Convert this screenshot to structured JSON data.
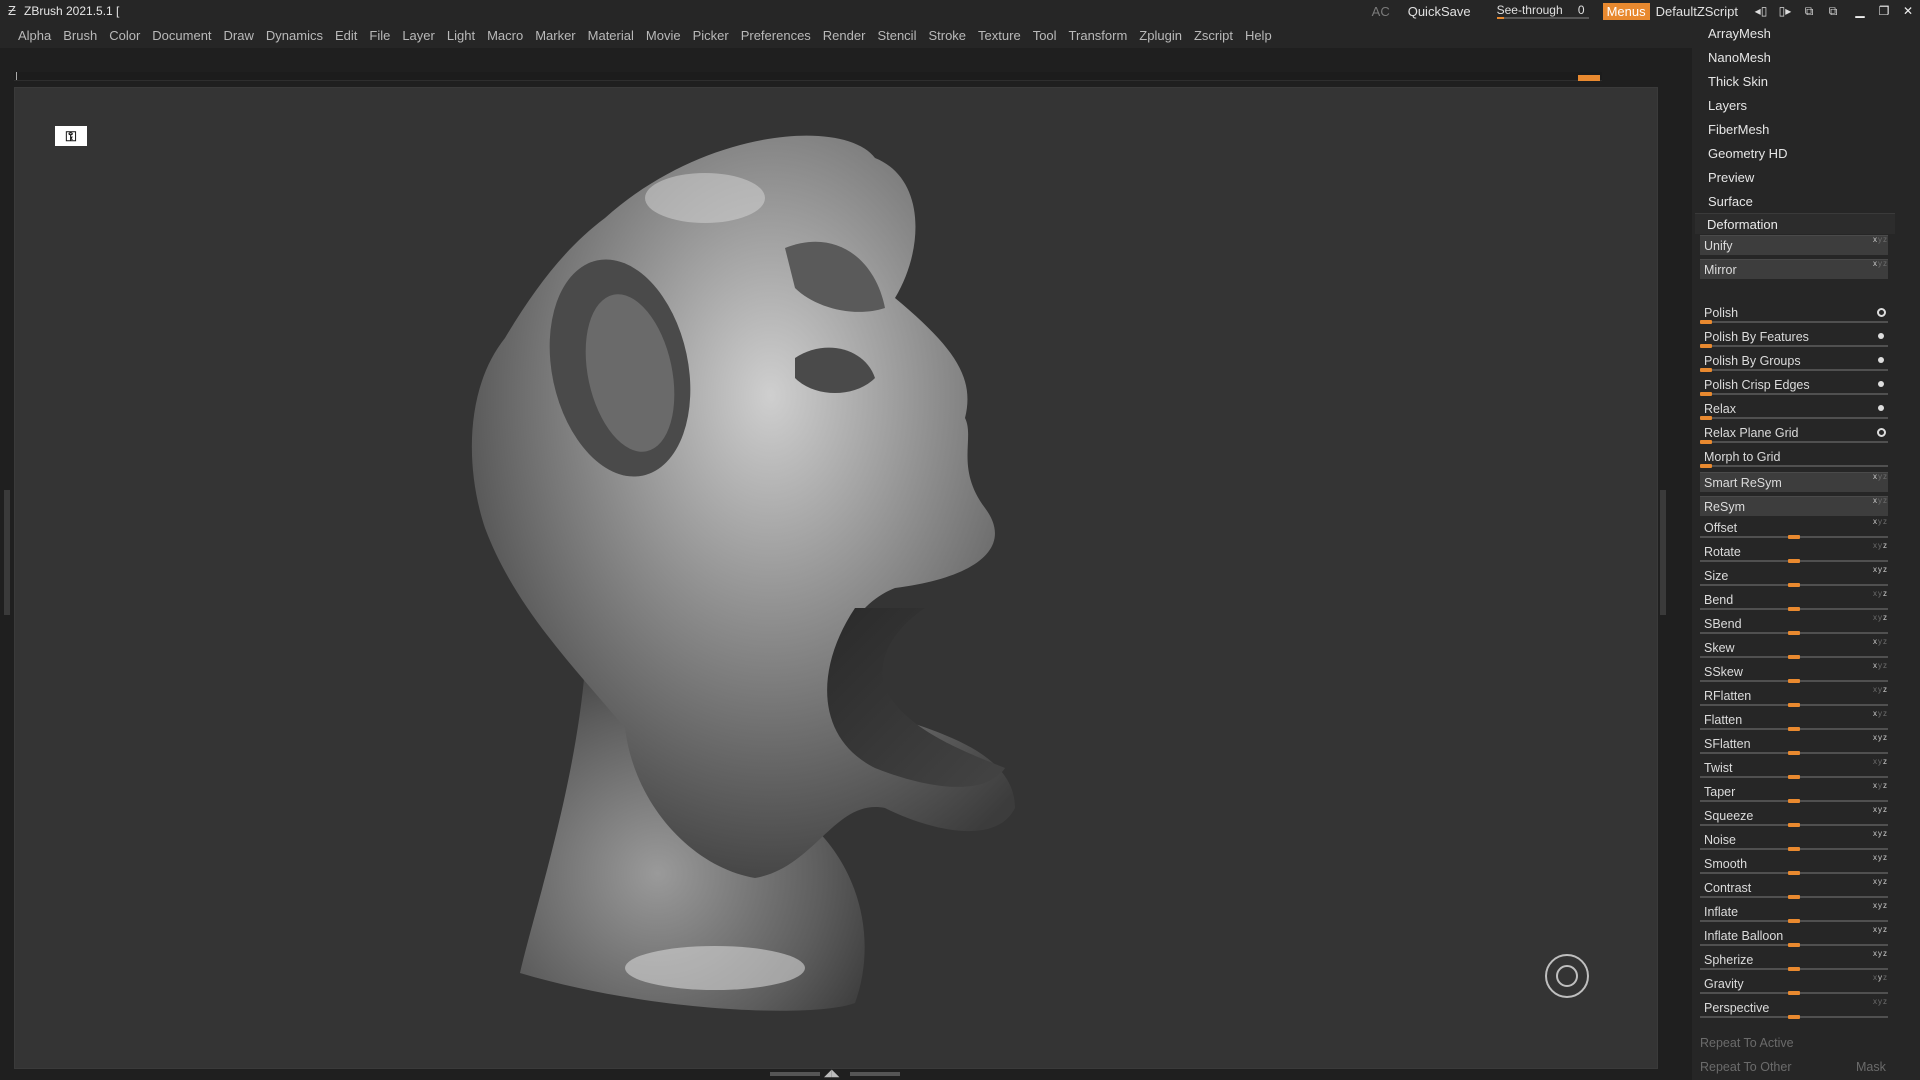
{
  "titlebar": {
    "app_title": "ZBrush 2021.5.1 [",
    "ac": "AC",
    "quicksave": "QuickSave",
    "see_through_label": "See-through",
    "see_through_value": "0",
    "see_through_level": 0.08,
    "menus": "Menus",
    "script": "DefaultZScript",
    "icons": [
      "logo-icon",
      "left-panel-icon",
      "right-panel-icon",
      "copy-icon",
      "paste-icon",
      "minimize-icon",
      "restore-icon",
      "close-icon"
    ]
  },
  "menubar": {
    "items": [
      "Alpha",
      "Brush",
      "Color",
      "Document",
      "Draw",
      "Dynamics",
      "Edit",
      "File",
      "Layer",
      "Light",
      "Macro",
      "Marker",
      "Material",
      "Movie",
      "Picker",
      "Preferences",
      "Render",
      "Stencil",
      "Stroke",
      "Texture",
      "Tool",
      "Transform",
      "Zplugin",
      "Zscript",
      "Help"
    ]
  },
  "viewport": {
    "model": "sculpted-head-mesh",
    "icons": [
      "perspective-lock-icon",
      "navigation-gizmo-icon"
    ]
  },
  "right_panel": {
    "sub_items": [
      "ArrayMesh",
      "NanoMesh",
      "Thick Skin",
      "Layers",
      "FiberMesh",
      "Geometry HD",
      "Preview",
      "Surface"
    ],
    "section_title": "Deformation",
    "buttons": [
      {
        "label": "Unify",
        "axes": "xyz",
        "active": "x"
      },
      {
        "label": "Mirror",
        "axes": "xyz",
        "active": "x"
      }
    ],
    "polish_rows": [
      {
        "label": "Polish",
        "radio": "ring"
      },
      {
        "label": "Polish By Features",
        "radio": "dot"
      },
      {
        "label": "Polish By Groups",
        "radio": "dot"
      },
      {
        "label": "Polish Crisp Edges",
        "radio": "dot"
      },
      {
        "label": "Relax",
        "radio": "dot"
      },
      {
        "label": "Relax Plane Grid",
        "radio": "ring"
      },
      {
        "label": "Morph to Grid",
        "radio": "none"
      }
    ],
    "sym_buttons": [
      {
        "label": "Smart ReSym",
        "axes": "xyz",
        "active": "x"
      },
      {
        "label": "ReSym",
        "axes": "xyz",
        "active": "x"
      }
    ],
    "sliders": [
      {
        "label": "Offset",
        "active": "x",
        "value": 0
      },
      {
        "label": "Rotate",
        "active": "z",
        "value": 0
      },
      {
        "label": "Size",
        "active": "xyz",
        "value": 0
      },
      {
        "label": "Bend",
        "active": "z",
        "value": 0
      },
      {
        "label": "SBend",
        "active": "z",
        "value": 0
      },
      {
        "label": "Skew",
        "active": "x",
        "value": 0
      },
      {
        "label": "SSkew",
        "active": "x",
        "value": 0
      },
      {
        "label": "RFlatten",
        "active": "z",
        "value": 0
      },
      {
        "label": "Flatten",
        "active": "x",
        "value": 0
      },
      {
        "label": "SFlatten",
        "active": "xyz",
        "value": 0
      },
      {
        "label": "Twist",
        "active": "z",
        "value": 0
      },
      {
        "label": "Taper",
        "active": "xz",
        "value": 0
      },
      {
        "label": "Squeeze",
        "active": "xyz",
        "value": 0
      },
      {
        "label": "Noise",
        "active": "xyz",
        "value": 0
      },
      {
        "label": "Smooth",
        "active": "xyz",
        "value": 0
      },
      {
        "label": "Contrast",
        "active": "xyz",
        "value": 0
      },
      {
        "label": "Inflate",
        "active": "xyz",
        "value": 0
      },
      {
        "label": "Inflate Balloon",
        "active": "xyz",
        "value": 0
      },
      {
        "label": "Spherize",
        "active": "xyz",
        "value": 0
      },
      {
        "label": "Gravity",
        "active": "y",
        "value": 0
      },
      {
        "label": "Perspective",
        "active": "",
        "value": 0
      }
    ],
    "repeat_active": "Repeat To Active",
    "repeat_other": "Repeat To Other",
    "mask": "Mask"
  },
  "colors": {
    "accent": "#e8892f",
    "background": "#1f1f1f",
    "viewport": "#343434"
  }
}
